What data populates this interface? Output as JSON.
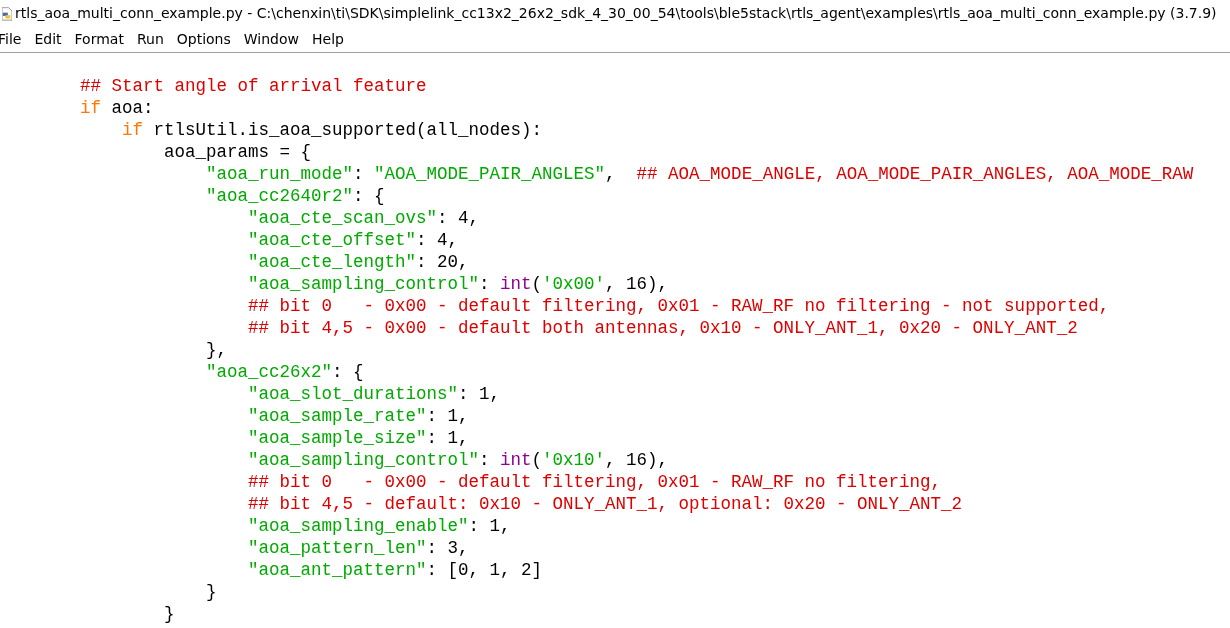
{
  "window": {
    "title": "rtls_aoa_multi_conn_example.py - C:\\chenxin\\ti\\SDK\\simplelink_cc13x2_26x2_sdk_4_30_00_54\\tools\\ble5stack\\rtls_agent\\examples\\rtls_aoa_multi_conn_example.py (3.7.9)"
  },
  "menu": [
    "File",
    "Edit",
    "Format",
    "Run",
    "Options",
    "Window",
    "Help"
  ],
  "code": [
    {
      "tokens": [
        {
          "kind": "comment",
          "text": "## Start angle of arrival feature"
        }
      ]
    },
    {
      "tokens": [
        {
          "kind": "keyword",
          "text": "if"
        },
        {
          "kind": "plain",
          "text": " aoa:"
        }
      ],
      "children": [
        {
          "tokens": [
            {
              "kind": "keyword",
              "text": "if"
            },
            {
              "kind": "plain",
              "text": " rtlsUtil.is_aoa_supported(all_nodes):"
            }
          ],
          "children": [
            {
              "tokens": [
                {
                  "kind": "plain",
                  "text": "aoa_params = {"
                }
              ],
              "children": [
                {
                  "tokens": [
                    {
                      "kind": "string",
                      "text": "\"aoa_run_mode\""
                    },
                    {
                      "kind": "plain",
                      "text": ": "
                    },
                    {
                      "kind": "string",
                      "text": "\"AOA_MODE_PAIR_ANGLES\""
                    },
                    {
                      "kind": "plain",
                      "text": ",  "
                    },
                    {
                      "kind": "comment",
                      "text": "## AOA_MODE_ANGLE, AOA_MODE_PAIR_ANGLES, AOA_MODE_RAW"
                    }
                  ]
                },
                {
                  "tokens": [
                    {
                      "kind": "string",
                      "text": "\"aoa_cc2640r2\""
                    },
                    {
                      "kind": "plain",
                      "text": ": {"
                    }
                  ],
                  "children": [
                    {
                      "tokens": [
                        {
                          "kind": "string",
                          "text": "\"aoa_cte_scan_ovs\""
                        },
                        {
                          "kind": "plain",
                          "text": ": 4,"
                        }
                      ]
                    },
                    {
                      "tokens": [
                        {
                          "kind": "string",
                          "text": "\"aoa_cte_offset\""
                        },
                        {
                          "kind": "plain",
                          "text": ": 4,"
                        }
                      ]
                    },
                    {
                      "tokens": [
                        {
                          "kind": "string",
                          "text": "\"aoa_cte_length\""
                        },
                        {
                          "kind": "plain",
                          "text": ": 20,"
                        }
                      ]
                    },
                    {
                      "tokens": [
                        {
                          "kind": "string",
                          "text": "\"aoa_sampling_control\""
                        },
                        {
                          "kind": "plain",
                          "text": ": "
                        },
                        {
                          "kind": "builtin",
                          "text": "int"
                        },
                        {
                          "kind": "plain",
                          "text": "("
                        },
                        {
                          "kind": "string",
                          "text": "'0x00'"
                        },
                        {
                          "kind": "plain",
                          "text": ", 16),"
                        }
                      ]
                    },
                    {
                      "tokens": [
                        {
                          "kind": "comment",
                          "text": "## bit 0   - 0x00 - default filtering, 0x01 - RAW_RF no filtering - not supported,"
                        }
                      ]
                    },
                    {
                      "tokens": [
                        {
                          "kind": "comment",
                          "text": "## bit 4,5 - 0x00 - default both antennas, 0x10 - ONLY_ANT_1, 0x20 - ONLY_ANT_2"
                        }
                      ]
                    }
                  ]
                },
                {
                  "tokens": [
                    {
                      "kind": "plain",
                      "text": "},"
                    }
                  ]
                },
                {
                  "tokens": [
                    {
                      "kind": "string",
                      "text": "\"aoa_cc26x2\""
                    },
                    {
                      "kind": "plain",
                      "text": ": {"
                    }
                  ],
                  "children": [
                    {
                      "tokens": [
                        {
                          "kind": "string",
                          "text": "\"aoa_slot_durations\""
                        },
                        {
                          "kind": "plain",
                          "text": ": 1,"
                        }
                      ]
                    },
                    {
                      "tokens": [
                        {
                          "kind": "string",
                          "text": "\"aoa_sample_rate\""
                        },
                        {
                          "kind": "plain",
                          "text": ": 1,"
                        }
                      ]
                    },
                    {
                      "tokens": [
                        {
                          "kind": "string",
                          "text": "\"aoa_sample_size\""
                        },
                        {
                          "kind": "plain",
                          "text": ": 1,"
                        }
                      ]
                    },
                    {
                      "tokens": [
                        {
                          "kind": "string",
                          "text": "\"aoa_sampling_control\""
                        },
                        {
                          "kind": "plain",
                          "text": ": "
                        },
                        {
                          "kind": "builtin",
                          "text": "int"
                        },
                        {
                          "kind": "plain",
                          "text": "("
                        },
                        {
                          "kind": "string",
                          "text": "'0x10'"
                        },
                        {
                          "kind": "plain",
                          "text": ", 16),"
                        }
                      ]
                    },
                    {
                      "tokens": [
                        {
                          "kind": "comment",
                          "text": "## bit 0   - 0x00 - default filtering, 0x01 - RAW_RF no filtering,"
                        }
                      ]
                    },
                    {
                      "tokens": [
                        {
                          "kind": "comment",
                          "text": "## bit 4,5 - default: 0x10 - ONLY_ANT_1, optional: 0x20 - ONLY_ANT_2"
                        }
                      ]
                    },
                    {
                      "tokens": [
                        {
                          "kind": "string",
                          "text": "\"aoa_sampling_enable\""
                        },
                        {
                          "kind": "plain",
                          "text": ": 1,"
                        }
                      ]
                    },
                    {
                      "tokens": [
                        {
                          "kind": "string",
                          "text": "\"aoa_pattern_len\""
                        },
                        {
                          "kind": "plain",
                          "text": ": 3,"
                        }
                      ]
                    },
                    {
                      "tokens": [
                        {
                          "kind": "string",
                          "text": "\"aoa_ant_pattern\""
                        },
                        {
                          "kind": "plain",
                          "text": ": [0, 1, 2]"
                        }
                      ]
                    }
                  ]
                },
                {
                  "tokens": [
                    {
                      "kind": "plain",
                      "text": "}"
                    }
                  ]
                }
              ]
            },
            {
              "tokens": [
                {
                  "kind": "plain",
                  "text": "}"
                }
              ]
            }
          ]
        }
      ]
    }
  ]
}
